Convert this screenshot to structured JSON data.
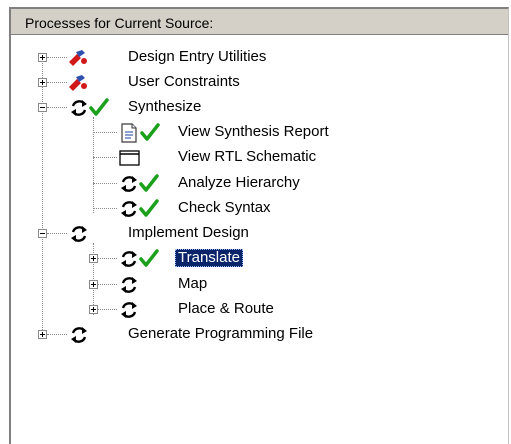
{
  "panel": {
    "title": "Processes for Current Source:"
  },
  "tree": {
    "items": [
      {
        "label": "Design Entry Utilities",
        "expander": "plus",
        "icon": "tools-icon"
      },
      {
        "label": "User Constraints",
        "expander": "plus",
        "icon": "tools-icon"
      },
      {
        "label": "Synthesize",
        "expander": "minus",
        "icon": "process-refresh-icon",
        "status": "check-mark-icon"
      },
      {
        "label": "View Synthesis Report",
        "icon": "report-icon",
        "status": "check-mark-icon"
      },
      {
        "label": "View RTL Schematic",
        "icon": "schematic-window-icon"
      },
      {
        "label": "Analyze Hierarchy",
        "icon": "process-refresh-icon",
        "status": "check-mark-icon"
      },
      {
        "label": "Check Syntax",
        "icon": "process-refresh-icon",
        "status": "check-mark-icon"
      },
      {
        "label": "Implement Design",
        "expander": "minus",
        "icon": "process-refresh-icon"
      },
      {
        "label": "Translate",
        "expander": "plus",
        "icon": "process-refresh-icon",
        "status": "check-mark-icon",
        "selected": true
      },
      {
        "label": "Map",
        "expander": "plus",
        "icon": "process-refresh-icon"
      },
      {
        "label": "Place & Route",
        "expander": "plus",
        "icon": "process-refresh-icon"
      },
      {
        "label": "Generate Programming File",
        "expander": "plus",
        "icon": "process-refresh-icon"
      }
    ]
  },
  "colors": {
    "selection": "#0a246a",
    "check": "#1aa01a",
    "tools_red": "#d01818",
    "tools_blue": "#3050b0"
  }
}
